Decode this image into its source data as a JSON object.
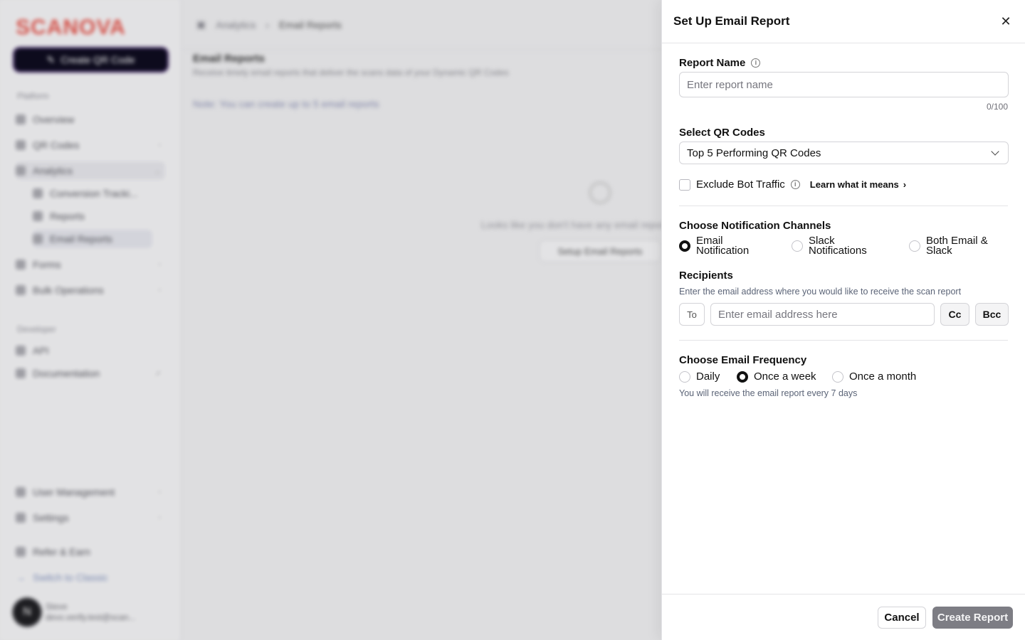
{
  "background": {
    "logo": "SCANOVA",
    "create_button": "Create QR Code",
    "section_platform": "Platform",
    "nav": [
      {
        "label": "Overview"
      },
      {
        "label": "QR Codes"
      },
      {
        "label": "Analytics"
      },
      {
        "label": "Conversion Tracki..."
      },
      {
        "label": "Reports"
      },
      {
        "label": "Email Reports"
      },
      {
        "label": "Forms"
      },
      {
        "label": "Bulk Operations"
      }
    ],
    "section_developer": "Developer",
    "dev_nav": [
      {
        "label": "API"
      },
      {
        "label": "Documentation"
      }
    ],
    "bottom_nav": [
      {
        "label": "User Management"
      },
      {
        "label": "Settings"
      },
      {
        "label": "Refer & Earn"
      },
      {
        "label": "Switch to Classic"
      }
    ],
    "avatar_letter": "N",
    "user_name": "Steve",
    "user_email": "devx.verify.test@scan...",
    "breadcrumb": [
      "Analytics",
      "Email Reports"
    ],
    "page_title": "Email Reports",
    "page_subtitle": "Receive timely email reports that deliver the scans data of your Dynamic QR Codes",
    "note": "Note: You can create up to 5 email reports",
    "empty_text": "Looks like you don't have any email reports",
    "setup_button": "Setup Email Reports"
  },
  "drawer": {
    "title": "Set Up Email Report",
    "report_name": {
      "label": "Report Name",
      "placeholder": "Enter report name",
      "value": "",
      "counter": "0/100"
    },
    "qr_codes": {
      "label": "Select QR Codes",
      "selected": "Top 5 Performing QR Codes"
    },
    "exclude_bot": {
      "label": "Exclude Bot Traffic",
      "checked": false,
      "link": "Learn what it means"
    },
    "channels": {
      "label": "Choose Notification Channels",
      "options": [
        {
          "line1": "Email",
          "line2": "Notification",
          "selected": true
        },
        {
          "line1": "Slack",
          "line2": "Notifications",
          "selected": false
        },
        {
          "line1": "Both Email &",
          "line2": "Slack",
          "selected": false
        }
      ]
    },
    "recipients": {
      "label": "Recipients",
      "help": "Enter the email address where you would like to receive the scan report",
      "to_label": "To",
      "placeholder": "Enter email address here",
      "cc_label": "Cc",
      "bcc_label": "Bcc"
    },
    "frequency": {
      "label": "Choose Email Frequency",
      "options": [
        {
          "label": "Daily",
          "selected": false
        },
        {
          "label": "Once a week",
          "selected": true
        },
        {
          "label": "Once a month",
          "selected": false
        }
      ],
      "help": "You will receive the email report every 7 days"
    },
    "footer": {
      "cancel": "Cancel",
      "create": "Create Report"
    }
  }
}
